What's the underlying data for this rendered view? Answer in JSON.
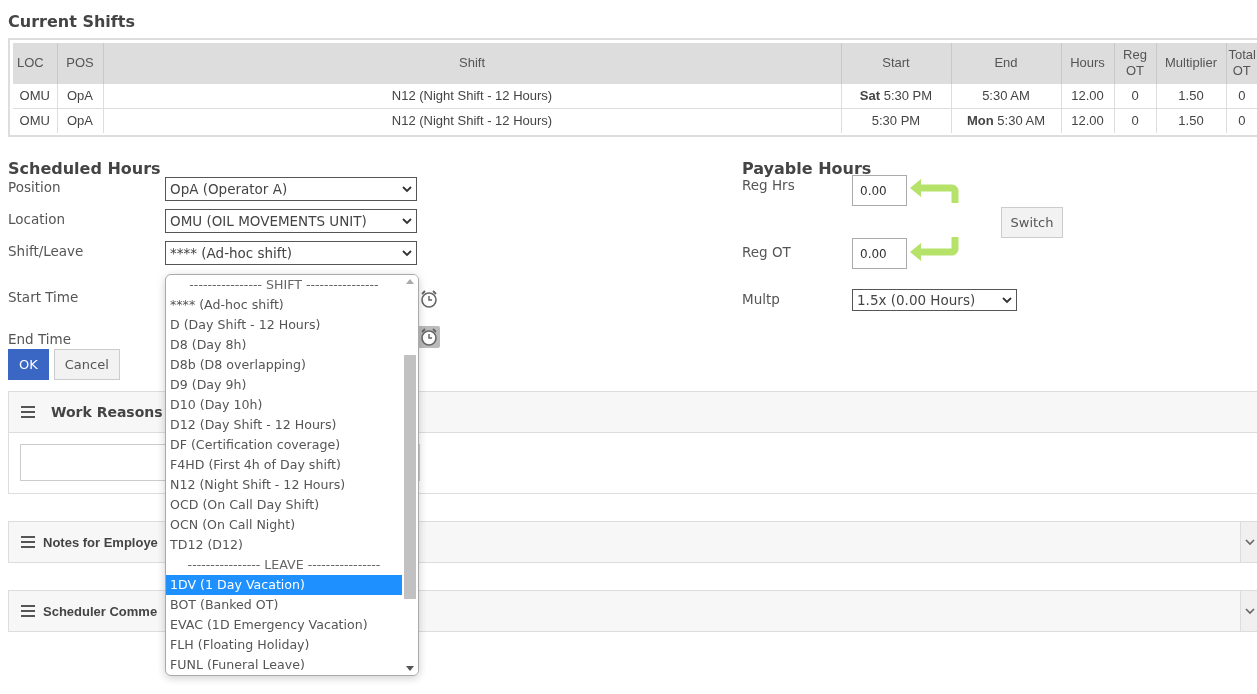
{
  "shifts": {
    "title": "Current Shifts",
    "columns": [
      {
        "label": "LOC"
      },
      {
        "label": "POS"
      },
      {
        "label": "Shift"
      },
      {
        "label": "Start"
      },
      {
        "label": "End"
      },
      {
        "label": "Hours"
      },
      {
        "label": "Reg OT"
      },
      {
        "label": "Multiplier"
      },
      {
        "label": "Total OT"
      }
    ],
    "rows": [
      {
        "cells": [
          "OMU",
          "OpA",
          "N12 (Night Shift - 12 Hours)",
          "**Sat** 5:30 PM",
          "5:30 AM",
          "12.00",
          "0",
          "1.50",
          "0"
        ]
      },
      {
        "cells": [
          "OMU",
          "OpA",
          "N12 (Night Shift - 12 Hours)",
          "5:30 PM",
          "**Mon** 5:30 AM",
          "12.00",
          "0",
          "1.50",
          "0"
        ]
      }
    ]
  },
  "scheduled": {
    "title": "Scheduled Hours",
    "fields": [
      {
        "label": "Position",
        "value": "OpA (Operator A)"
      },
      {
        "label": "Location",
        "value": "OMU (OIL MOVEMENTS UNIT)"
      },
      {
        "label": "Shift/Leave",
        "value": "**** (Ad-hoc shift)"
      }
    ],
    "time_fields": [
      {
        "label": "Start Time",
        "kind": "plain"
      },
      {
        "label": "End Time",
        "kind": "pressed"
      }
    ],
    "buttons": [
      {
        "label": "OK",
        "kind": "primary"
      },
      {
        "label": "Cancel",
        "kind": "default"
      }
    ]
  },
  "payable": {
    "title": "Payable Hours",
    "reg_hrs": {
      "label": "Reg Hrs",
      "value": "0.00"
    },
    "reg_ot": {
      "label": "Reg OT",
      "value": "0.00"
    },
    "switch_button": "Switch",
    "multp": {
      "label": "Multp",
      "value": "1.5x (0.00 Hours)"
    }
  },
  "panels": [
    {
      "title": "Work Reasons",
      "kind": "textarea"
    },
    {
      "title": "Notes for Employe",
      "kind": "collapsible"
    },
    {
      "title": "Scheduler Comme",
      "kind": "collapsible"
    }
  ],
  "dropdown": {
    "options": [
      {
        "label": "---------------- SHIFT ----------------",
        "kind": "header",
        "selected": false
      },
      {
        "label": "**** (Ad-hoc shift)",
        "kind": "option",
        "selected": false
      },
      {
        "label": "D (Day Shift - 12 Hours)",
        "kind": "option",
        "selected": false
      },
      {
        "label": "D8 (Day 8h)",
        "kind": "option",
        "selected": false
      },
      {
        "label": "D8b (D8 overlapping)",
        "kind": "option",
        "selected": false
      },
      {
        "label": "D9 (Day 9h)",
        "kind": "option",
        "selected": false
      },
      {
        "label": "D10 (Day 10h)",
        "kind": "option",
        "selected": false
      },
      {
        "label": "D12 (Day Shift - 12 Hours)",
        "kind": "option",
        "selected": false
      },
      {
        "label": "DF (Certification coverage)",
        "kind": "option",
        "selected": false
      },
      {
        "label": "F4HD (First 4h of Day shift)",
        "kind": "option",
        "selected": false
      },
      {
        "label": "N12 (Night Shift - 12 Hours)",
        "kind": "option",
        "selected": false
      },
      {
        "label": "OCD (On Call Day Shift)",
        "kind": "option",
        "selected": false
      },
      {
        "label": "OCN (On Call Night)",
        "kind": "option",
        "selected": false
      },
      {
        "label": "TD12 (D12)",
        "kind": "option",
        "selected": false
      },
      {
        "label": "---------------- LEAVE ----------------",
        "kind": "header",
        "selected": false
      },
      {
        "label": "1DV (1 Day Vacation)",
        "kind": "option",
        "selected": true
      },
      {
        "label": "BOT (Banked OT)",
        "kind": "option",
        "selected": false
      },
      {
        "label": "EVAC (1D Emergency Vacation)",
        "kind": "option",
        "selected": false
      },
      {
        "label": "FLH (Floating Holiday)",
        "kind": "option",
        "selected": false
      },
      {
        "label": "FUNL (Funeral Leave)",
        "kind": "option",
        "selected": false
      }
    ]
  }
}
